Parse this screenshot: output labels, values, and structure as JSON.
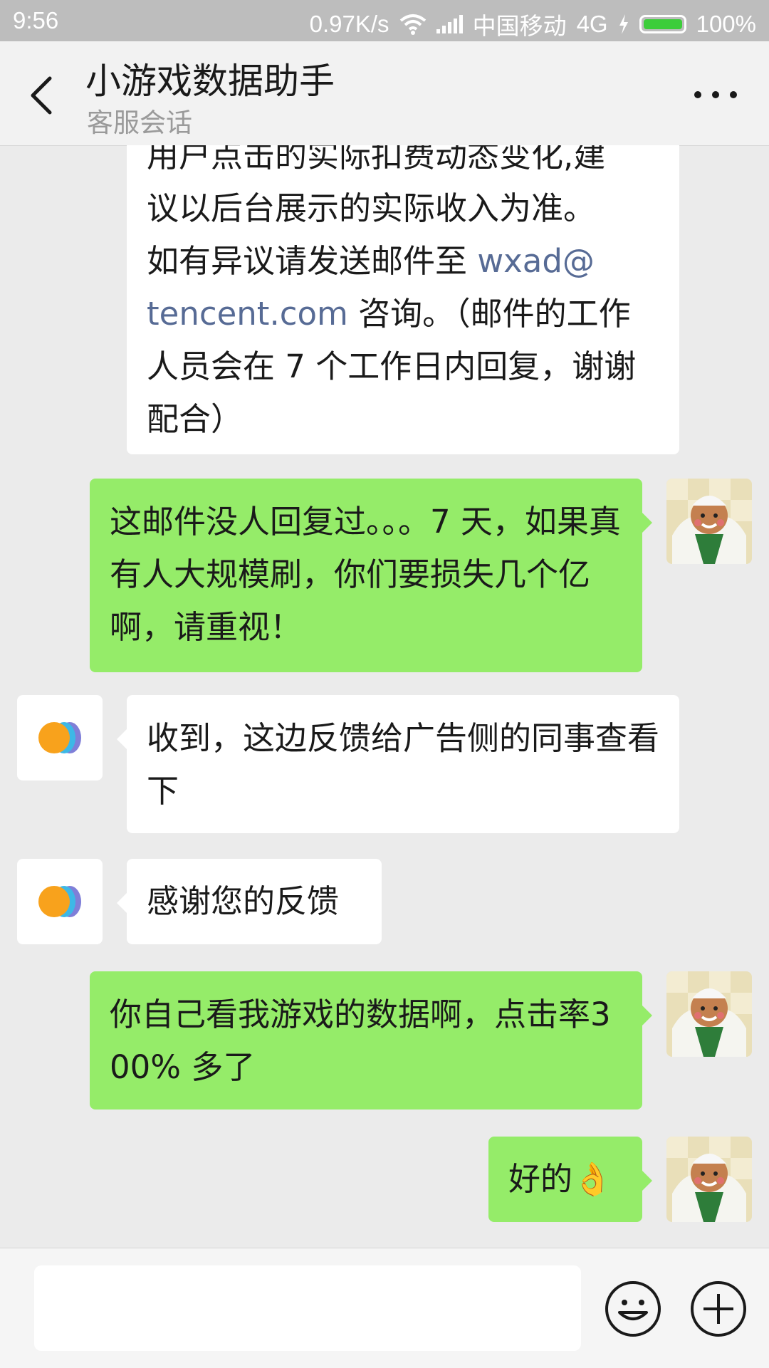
{
  "status_bar": {
    "time": "9:56",
    "speed": "0.97K/s",
    "carrier": "中国移动",
    "network": "4G",
    "battery": "100%",
    "battery_level": 1.0
  },
  "header": {
    "title": "小游戏数据助手",
    "subtitle": "客服会话",
    "back_icon": "chevron-left-icon",
    "more_icon": "more-dots-icon"
  },
  "messages": [
    {
      "sender": "service",
      "partial_top_line": "用户点击的实际扣费动态变化,建",
      "text_lines": [
        "议以后台展示的实际收入为准。",
        "如有异议请发送邮件至 "
      ],
      "link_text_1": "wxad@",
      "link_text_2": "tencent.com",
      "after_link": " 咨询。（邮件的工作",
      "tail_lines": [
        "人员会在 7 个工作日内回复，谢谢",
        "配合）"
      ]
    },
    {
      "sender": "me",
      "text": "这邮件没人回复过。。。7 天，如果真有人大规模刷，你们要损失几个亿啊，请重视！"
    },
    {
      "sender": "service",
      "text": "收到，这边反馈给广告侧的同事查看下"
    },
    {
      "sender": "service",
      "text": "感谢您的反馈"
    },
    {
      "sender": "me",
      "text": "你自己看我游戏的数据啊，点击率300% 多了"
    },
    {
      "sender": "me",
      "text": "好的",
      "emoji": "👌"
    }
  ],
  "input_bar": {
    "emoji_icon": "smiley-icon",
    "plus_icon": "plus-circle-icon"
  },
  "colors": {
    "green_bubble": "#95ec69",
    "white_bubble": "#ffffff",
    "link": "#576b95",
    "background": "#ebebeb"
  }
}
